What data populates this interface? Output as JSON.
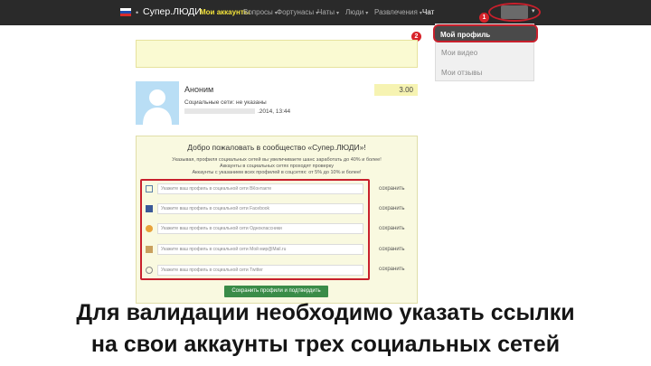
{
  "header": {
    "brand": "Супер.ЛЮДИ",
    "nav_items": [
      {
        "label": "Мои аккаунты",
        "active": true,
        "has_caret": false
      },
      {
        "label": "Вопросы",
        "active": false,
        "has_caret": true
      },
      {
        "label": "Фортунасы",
        "active": false,
        "has_caret": true
      },
      {
        "label": "Чаты",
        "active": false,
        "has_caret": true
      },
      {
        "label": "Люди",
        "active": false,
        "has_caret": true
      },
      {
        "label": "Развлечения",
        "active": false,
        "has_caret": true
      },
      {
        "label": "Чат",
        "active": false,
        "has_caret": false
      }
    ]
  },
  "markers": [
    "1",
    "2",
    "3",
    "4"
  ],
  "dropdown": {
    "items": [
      "Мой профиль",
      "Мои видео",
      "Мои отзывы"
    ]
  },
  "profile": {
    "name": "Аноним",
    "status": "Социальные сети: не указаны",
    "date": ".2014, 13:44",
    "balance": "3.00"
  },
  "welcome": {
    "title": "Добро пожаловать в сообщество «Супер.ЛЮДИ»!",
    "lines": [
      "Указывая, профиля социальных сетей вы увеличиваете шанс заработать до 40% и более!",
      "Аккаунты в социальных сетях проходят проверку",
      "Аккаунты с указанием всех профилей в соцсетях: от 5% до 10% и более!"
    ],
    "rows": [
      {
        "placeholder": "Укажите ваш профиль в социальной сети ВКонтакте",
        "save": "сохранить",
        "icon": "vk-icon",
        "color": "#5a7fa8"
      },
      {
        "placeholder": "Укажите ваш профиль в социальной сети Facebook",
        "save": "сохранить",
        "icon": "facebook-icon",
        "color": "#3b5998"
      },
      {
        "placeholder": "Укажите ваш профиль в социальной сети Одноклассники",
        "save": "сохранить",
        "icon": "odnoklassniki-icon",
        "color": "#e8a23a"
      },
      {
        "placeholder": "Укажите ваш профиль в социальной сети Мой мир@Mail.ru",
        "save": "сохранить",
        "icon": "mailru-icon",
        "color": "#c9a05e"
      },
      {
        "placeholder": "Укажите ваш профиль в социальной сети Twitter",
        "save": "сохранить",
        "icon": "twitter-icon",
        "color": "#8a8a8a"
      }
    ],
    "submit": "Сохранить профили и подтвердить"
  },
  "caption": {
    "line1": "Для валидации необходимо указать ссылки",
    "line2": "на свои аккаунты трех социальных  сетей"
  }
}
